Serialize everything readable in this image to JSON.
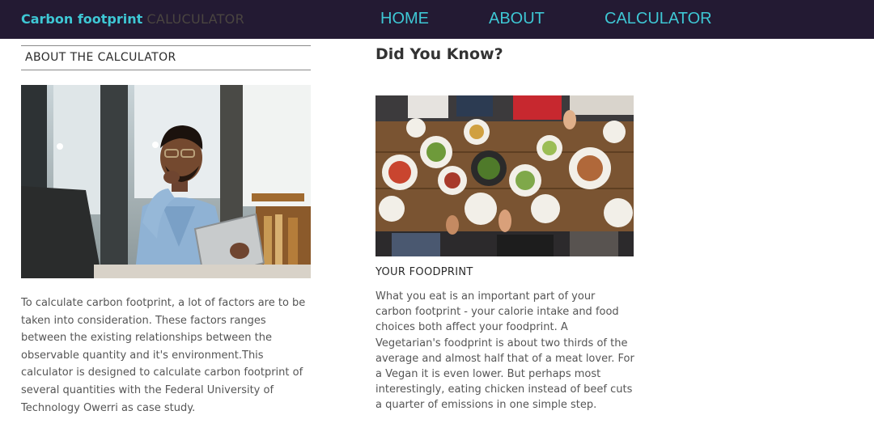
{
  "nav": {
    "brand_main": "Carbon footprint",
    "brand_sub": "CALUCULATOR",
    "links": [
      "HOME",
      "ABOUT",
      "CALCULATOR"
    ]
  },
  "about": {
    "heading": "ABOUT THE CALCULATOR",
    "body": "To calculate carbon footprint, a lot of factors are to be taken into consideration. These factors ranges between the existing relationships between the observable quantity and it's environment.This calculator is designed to calculate carbon footprint of several quantities with the Federal University of Technology Owerri as case study."
  },
  "did_you_know": {
    "heading": "Did You Know?",
    "card_title": "YOUR FOODPRINT",
    "card_body": "What you eat is an important part of your carbon footprint - your calorie intake and food choices both affect your foodprint. A Vegetarian's foodprint is about two thirds of the average and almost half that of a meat lover. For a Vegan it is even lower. But perhaps most interestingly, eating chicken instead of beef cuts a quarter of emissions in one simple step."
  }
}
